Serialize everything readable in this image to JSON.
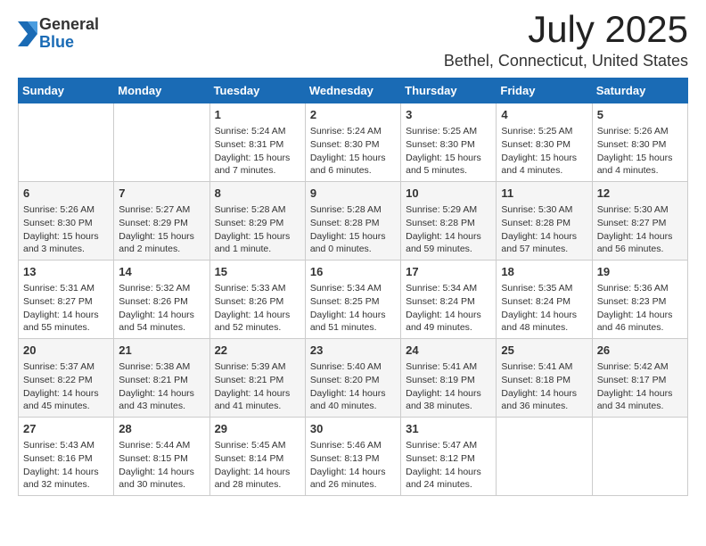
{
  "header": {
    "logo_general": "General",
    "logo_blue": "Blue",
    "month": "July 2025",
    "location": "Bethel, Connecticut, United States"
  },
  "weekdays": [
    "Sunday",
    "Monday",
    "Tuesday",
    "Wednesday",
    "Thursday",
    "Friday",
    "Saturday"
  ],
  "weeks": [
    [
      {
        "day": "",
        "data": ""
      },
      {
        "day": "",
        "data": ""
      },
      {
        "day": "1",
        "data": "Sunrise: 5:24 AM\nSunset: 8:31 PM\nDaylight: 15 hours and 7 minutes."
      },
      {
        "day": "2",
        "data": "Sunrise: 5:24 AM\nSunset: 8:30 PM\nDaylight: 15 hours and 6 minutes."
      },
      {
        "day": "3",
        "data": "Sunrise: 5:25 AM\nSunset: 8:30 PM\nDaylight: 15 hours and 5 minutes."
      },
      {
        "day": "4",
        "data": "Sunrise: 5:25 AM\nSunset: 8:30 PM\nDaylight: 15 hours and 4 minutes."
      },
      {
        "day": "5",
        "data": "Sunrise: 5:26 AM\nSunset: 8:30 PM\nDaylight: 15 hours and 4 minutes."
      }
    ],
    [
      {
        "day": "6",
        "data": "Sunrise: 5:26 AM\nSunset: 8:30 PM\nDaylight: 15 hours and 3 minutes."
      },
      {
        "day": "7",
        "data": "Sunrise: 5:27 AM\nSunset: 8:29 PM\nDaylight: 15 hours and 2 minutes."
      },
      {
        "day": "8",
        "data": "Sunrise: 5:28 AM\nSunset: 8:29 PM\nDaylight: 15 hours and 1 minute."
      },
      {
        "day": "9",
        "data": "Sunrise: 5:28 AM\nSunset: 8:28 PM\nDaylight: 15 hours and 0 minutes."
      },
      {
        "day": "10",
        "data": "Sunrise: 5:29 AM\nSunset: 8:28 PM\nDaylight: 14 hours and 59 minutes."
      },
      {
        "day": "11",
        "data": "Sunrise: 5:30 AM\nSunset: 8:28 PM\nDaylight: 14 hours and 57 minutes."
      },
      {
        "day": "12",
        "data": "Sunrise: 5:30 AM\nSunset: 8:27 PM\nDaylight: 14 hours and 56 minutes."
      }
    ],
    [
      {
        "day": "13",
        "data": "Sunrise: 5:31 AM\nSunset: 8:27 PM\nDaylight: 14 hours and 55 minutes."
      },
      {
        "day": "14",
        "data": "Sunrise: 5:32 AM\nSunset: 8:26 PM\nDaylight: 14 hours and 54 minutes."
      },
      {
        "day": "15",
        "data": "Sunrise: 5:33 AM\nSunset: 8:26 PM\nDaylight: 14 hours and 52 minutes."
      },
      {
        "day": "16",
        "data": "Sunrise: 5:34 AM\nSunset: 8:25 PM\nDaylight: 14 hours and 51 minutes."
      },
      {
        "day": "17",
        "data": "Sunrise: 5:34 AM\nSunset: 8:24 PM\nDaylight: 14 hours and 49 minutes."
      },
      {
        "day": "18",
        "data": "Sunrise: 5:35 AM\nSunset: 8:24 PM\nDaylight: 14 hours and 48 minutes."
      },
      {
        "day": "19",
        "data": "Sunrise: 5:36 AM\nSunset: 8:23 PM\nDaylight: 14 hours and 46 minutes."
      }
    ],
    [
      {
        "day": "20",
        "data": "Sunrise: 5:37 AM\nSunset: 8:22 PM\nDaylight: 14 hours and 45 minutes."
      },
      {
        "day": "21",
        "data": "Sunrise: 5:38 AM\nSunset: 8:21 PM\nDaylight: 14 hours and 43 minutes."
      },
      {
        "day": "22",
        "data": "Sunrise: 5:39 AM\nSunset: 8:21 PM\nDaylight: 14 hours and 41 minutes."
      },
      {
        "day": "23",
        "data": "Sunrise: 5:40 AM\nSunset: 8:20 PM\nDaylight: 14 hours and 40 minutes."
      },
      {
        "day": "24",
        "data": "Sunrise: 5:41 AM\nSunset: 8:19 PM\nDaylight: 14 hours and 38 minutes."
      },
      {
        "day": "25",
        "data": "Sunrise: 5:41 AM\nSunset: 8:18 PM\nDaylight: 14 hours and 36 minutes."
      },
      {
        "day": "26",
        "data": "Sunrise: 5:42 AM\nSunset: 8:17 PM\nDaylight: 14 hours and 34 minutes."
      }
    ],
    [
      {
        "day": "27",
        "data": "Sunrise: 5:43 AM\nSunset: 8:16 PM\nDaylight: 14 hours and 32 minutes."
      },
      {
        "day": "28",
        "data": "Sunrise: 5:44 AM\nSunset: 8:15 PM\nDaylight: 14 hours and 30 minutes."
      },
      {
        "day": "29",
        "data": "Sunrise: 5:45 AM\nSunset: 8:14 PM\nDaylight: 14 hours and 28 minutes."
      },
      {
        "day": "30",
        "data": "Sunrise: 5:46 AM\nSunset: 8:13 PM\nDaylight: 14 hours and 26 minutes."
      },
      {
        "day": "31",
        "data": "Sunrise: 5:47 AM\nSunset: 8:12 PM\nDaylight: 14 hours and 24 minutes."
      },
      {
        "day": "",
        "data": ""
      },
      {
        "day": "",
        "data": ""
      }
    ]
  ]
}
